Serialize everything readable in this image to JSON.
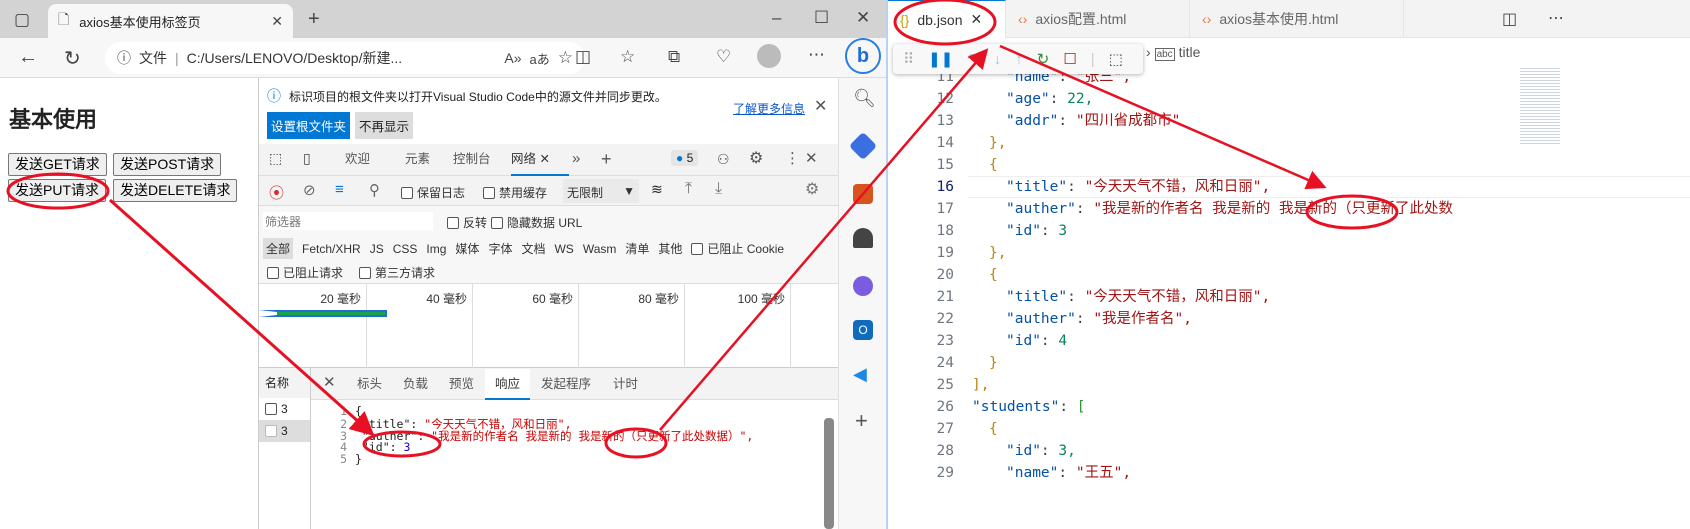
{
  "browser": {
    "tab_title": "axios基本使用标签页",
    "address_label": "文件",
    "address": "C:/Users/LENOVO/Desktop/新建...",
    "page": {
      "heading": "基本使用",
      "buttons": [
        "发送GET请求",
        "发送POST请求",
        "发送PUT请求",
        "发送DELETE请求"
      ]
    }
  },
  "devtools": {
    "info_text": "标识项目的根文件夹以打开Visual Studio Code中的源文件并同步更改。",
    "learn_more": "了解更多信息",
    "set_root": "设置根文件夹",
    "dont_show": "不再显示",
    "tabs": [
      "欢迎",
      "元素",
      "控制台",
      "网络"
    ],
    "issues_count": "5",
    "preserve_log": "保留日志",
    "disable_cache": "禁用缓存",
    "throttle": "无限制",
    "filter_placeholder": "筛选器",
    "invert": "反转",
    "hide_data_url": "隐藏数据 URL",
    "types": [
      "全部",
      "Fetch/XHR",
      "JS",
      "CSS",
      "Img",
      "媒体",
      "字体",
      "文档",
      "WS",
      "Wasm",
      "清单",
      "其他"
    ],
    "blocked_cookies": "已阻止 Cookie",
    "blocked_requests": "已阻止请求",
    "third_party": "第三方请求",
    "timeline": [
      "20 毫秒",
      "40 毫秒",
      "60 毫秒",
      "80 毫秒",
      "100 毫秒"
    ],
    "name_header": "名称",
    "requests": [
      "3",
      "3"
    ],
    "detail_tabs": [
      "标头",
      "负载",
      "预览",
      "响应",
      "发起程序",
      "计时"
    ],
    "response_lines": [
      {
        "n": "1",
        "t": "{"
      },
      {
        "n": "2",
        "k": "\"title\"",
        "v": "\"今天天气不错，风和日丽\","
      },
      {
        "n": "3",
        "k": "\"auther\"",
        "v": "\"我是新的作者名 我是新的 我是新的（只更新了此处数据）\","
      },
      {
        "n": "4",
        "k": "\"id\"",
        "num": "3"
      },
      {
        "n": "5",
        "t": "}"
      }
    ]
  },
  "vscode": {
    "tabs": [
      "db.json",
      "axios配置.html",
      "axios基本使用.html"
    ],
    "breadcrumb": "title",
    "lines": [
      {
        "n": "11",
        "i": 3,
        "k": "\"name\"",
        "s": "\"张三\","
      },
      {
        "n": "12",
        "i": 3,
        "k": "\"age\"",
        "num": "22,"
      },
      {
        "n": "13",
        "i": 3,
        "k": "\"addr\"",
        "s": "\"四川省成都市\""
      },
      {
        "n": "14",
        "i": 2,
        "p": "},"
      },
      {
        "n": "15",
        "i": 2,
        "p": "{"
      },
      {
        "n": "16",
        "i": 3,
        "k": "\"title\"",
        "s": "\"今天天气不错，风和日丽\","
      },
      {
        "n": "17",
        "i": 3,
        "k": "\"auther\"",
        "s": "\"我是新的作者名 我是新的 我是新的（只更新了此处数"
      },
      {
        "n": "18",
        "i": 3,
        "k": "\"id\"",
        "num": "3"
      },
      {
        "n": "19",
        "i": 2,
        "p": "},"
      },
      {
        "n": "20",
        "i": 2,
        "p": "{"
      },
      {
        "n": "21",
        "i": 3,
        "k": "\"title\"",
        "s": "\"今天天气不错，风和日丽\","
      },
      {
        "n": "22",
        "i": 3,
        "k": "\"auther\"",
        "s": "\"我是作者名\","
      },
      {
        "n": "23",
        "i": 3,
        "k": "\"id\"",
        "num": "4"
      },
      {
        "n": "24",
        "i": 2,
        "p": "}"
      },
      {
        "n": "25",
        "i": 1,
        "p": "],"
      },
      {
        "n": "26",
        "i": 1,
        "k": "\"students\"",
        "p2": "["
      },
      {
        "n": "27",
        "i": 2,
        "p": "{"
      },
      {
        "n": "28",
        "i": 3,
        "k": "\"id\"",
        "num": "3,"
      },
      {
        "n": "29",
        "i": 3,
        "k": "\"name\"",
        "s": "\"王五\","
      }
    ]
  },
  "colors": {
    "accent": "#0078d4",
    "annotation": "#e81123",
    "string": "#a31515",
    "key": "#0451a5",
    "number": "#098658"
  }
}
